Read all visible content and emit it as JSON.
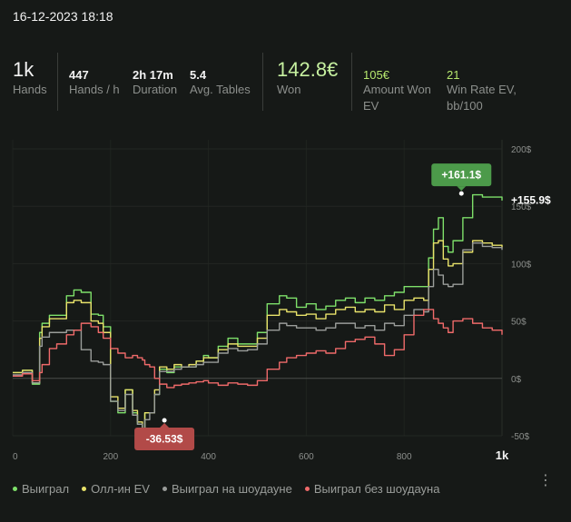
{
  "session": {
    "date": "16-12-2023 18:18"
  },
  "stats": [
    {
      "value": "1k",
      "label": "Hands"
    },
    {
      "value": "447",
      "label": "Hands / h"
    },
    {
      "value": "2h 17m",
      "label": "Duration"
    },
    {
      "value": "5.4",
      "label": "Avg. Tables"
    },
    {
      "value": "142.8€",
      "label": "Won"
    },
    {
      "value": "105€",
      "label": "Amount Won EV"
    },
    {
      "value": "21",
      "label": "Win Rate EV, bb/100"
    }
  ],
  "chart_data": {
    "type": "line",
    "xlim": [
      0,
      1000
    ],
    "ylim": [
      -50,
      200
    ],
    "x_ticks": [
      "0",
      "200",
      "400",
      "600",
      "800",
      "1k"
    ],
    "y_ticks": [
      "200$",
      "150$",
      "100$",
      "50$",
      "0$",
      "-50$"
    ],
    "series": [
      {
        "name": "Выиграл",
        "color": "#7ee06a",
        "x": [
          0,
          20,
          40,
          55,
          60,
          75,
          90,
          110,
          125,
          140,
          160,
          175,
          185,
          200,
          215,
          230,
          245,
          255,
          265,
          270,
          280,
          290,
          300,
          315,
          330,
          345,
          360,
          375,
          390,
          400,
          420,
          440,
          460,
          480,
          500,
          520,
          545,
          560,
          580,
          600,
          620,
          640,
          660,
          680,
          700,
          720,
          740,
          760,
          780,
          800,
          820,
          840,
          850,
          860,
          870,
          880,
          890,
          900,
          920,
          940,
          960,
          980,
          1000
        ],
        "y": [
          5,
          7,
          -5,
          40,
          48,
          55,
          55,
          72,
          77,
          75,
          56,
          55,
          45,
          -20,
          -30,
          -10,
          -30,
          -40,
          -45,
          -30,
          -30,
          -14,
          8,
          5,
          10,
          10,
          10,
          15,
          20,
          18,
          28,
          35,
          30,
          30,
          40,
          65,
          72,
          70,
          62,
          65,
          60,
          63,
          68,
          70,
          66,
          70,
          68,
          72,
          75,
          80,
          80,
          80,
          105,
          130,
          140,
          115,
          110,
          120,
          140,
          160,
          158,
          158,
          155
        ]
      },
      {
        "name": "Олл-ин EV",
        "color": "#e8e26a",
        "x": [
          0,
          20,
          40,
          55,
          60,
          75,
          90,
          110,
          125,
          140,
          160,
          175,
          185,
          200,
          215,
          230,
          245,
          255,
          265,
          270,
          280,
          290,
          300,
          315,
          330,
          345,
          360,
          375,
          390,
          400,
          420,
          440,
          460,
          480,
          500,
          520,
          545,
          560,
          580,
          600,
          620,
          640,
          660,
          680,
          700,
          720,
          740,
          760,
          780,
          800,
          820,
          840,
          850,
          860,
          870,
          880,
          890,
          900,
          920,
          940,
          960,
          980,
          1000
        ],
        "y": [
          5,
          7,
          -4,
          35,
          45,
          52,
          52,
          66,
          68,
          66,
          50,
          48,
          40,
          -16,
          -26,
          -10,
          -28,
          -38,
          -44,
          -30,
          -30,
          -10,
          10,
          8,
          12,
          10,
          12,
          15,
          18,
          18,
          25,
          30,
          28,
          28,
          35,
          55,
          60,
          58,
          55,
          56,
          52,
          56,
          60,
          62,
          58,
          60,
          58,
          64,
          60,
          68,
          70,
          68,
          95,
          118,
          120,
          104,
          98,
          100,
          110,
          120,
          118,
          116,
          114
        ]
      },
      {
        "name": "Выиграл на шоудауне",
        "color": "#9a9d9a",
        "x": [
          0,
          20,
          40,
          55,
          60,
          75,
          90,
          110,
          125,
          140,
          160,
          175,
          185,
          200,
          215,
          230,
          245,
          255,
          265,
          270,
          280,
          290,
          300,
          315,
          330,
          345,
          360,
          375,
          390,
          400,
          420,
          440,
          460,
          480,
          500,
          520,
          545,
          560,
          580,
          600,
          620,
          640,
          660,
          680,
          700,
          720,
          740,
          760,
          780,
          800,
          820,
          840,
          850,
          860,
          870,
          880,
          890,
          900,
          920,
          940,
          960,
          980,
          1000
        ],
        "y": [
          3,
          5,
          -4,
          28,
          36,
          40,
          40,
          42,
          42,
          25,
          15,
          14,
          12,
          -20,
          -28,
          -14,
          -32,
          -40,
          -46,
          -36,
          -30,
          -14,
          6,
          6,
          8,
          10,
          10,
          12,
          14,
          14,
          22,
          26,
          24,
          25,
          30,
          42,
          48,
          46,
          44,
          44,
          42,
          44,
          48,
          48,
          44,
          46,
          42,
          48,
          46,
          55,
          60,
          58,
          80,
          95,
          90,
          82,
          80,
          82,
          112,
          118,
          115,
          114,
          112
        ]
      },
      {
        "name": "Выиграл без шоудауна",
        "color": "#ef6a6a",
        "x": [
          0,
          20,
          40,
          55,
          60,
          75,
          90,
          110,
          125,
          140,
          160,
          175,
          185,
          200,
          215,
          230,
          245,
          255,
          265,
          270,
          280,
          290,
          300,
          315,
          330,
          345,
          360,
          375,
          390,
          400,
          420,
          440,
          460,
          480,
          500,
          520,
          545,
          560,
          580,
          600,
          620,
          640,
          660,
          680,
          700,
          720,
          740,
          760,
          780,
          800,
          820,
          840,
          850,
          860,
          870,
          880,
          890,
          900,
          920,
          940,
          960,
          980,
          1000
        ],
        "y": [
          2,
          4,
          -2,
          5,
          12,
          26,
          30,
          38,
          42,
          48,
          45,
          40,
          35,
          26,
          22,
          18,
          20,
          18,
          16,
          12,
          10,
          0,
          -5,
          -8,
          -6,
          -5,
          -4,
          -3,
          -2,
          -4,
          -6,
          -4,
          -5,
          -6,
          -2,
          8,
          14,
          18,
          20,
          22,
          24,
          22,
          26,
          32,
          34,
          36,
          30,
          20,
          25,
          38,
          55,
          60,
          60,
          52,
          48,
          44,
          40,
          50,
          52,
          48,
          44,
          42,
          38
        ]
      }
    ],
    "annotations": [
      {
        "label": "+161.1$",
        "x": 917,
        "y": 161.1,
        "color": "#4c9a4a",
        "position": "above"
      },
      {
        "label": "-36.53$",
        "x": 310,
        "y": -36.53,
        "color": "#b24a48",
        "position": "below"
      },
      {
        "label": "+155.9$",
        "x": 1000,
        "y": 155.9,
        "color": "#ffffff",
        "position": "right"
      }
    ],
    "legend_position": "bottom-left"
  },
  "legend": [
    {
      "label": "Выиграл",
      "color": "#7ee06a"
    },
    {
      "label": "Олл-ин EV",
      "color": "#e8e26a"
    },
    {
      "label": "Выиграл на шоудауне",
      "color": "#9a9d9a"
    },
    {
      "label": "Выиграл без шоудауна",
      "color": "#ef6a6a"
    }
  ],
  "menu": {
    "icon": "more-vertical-icon"
  }
}
